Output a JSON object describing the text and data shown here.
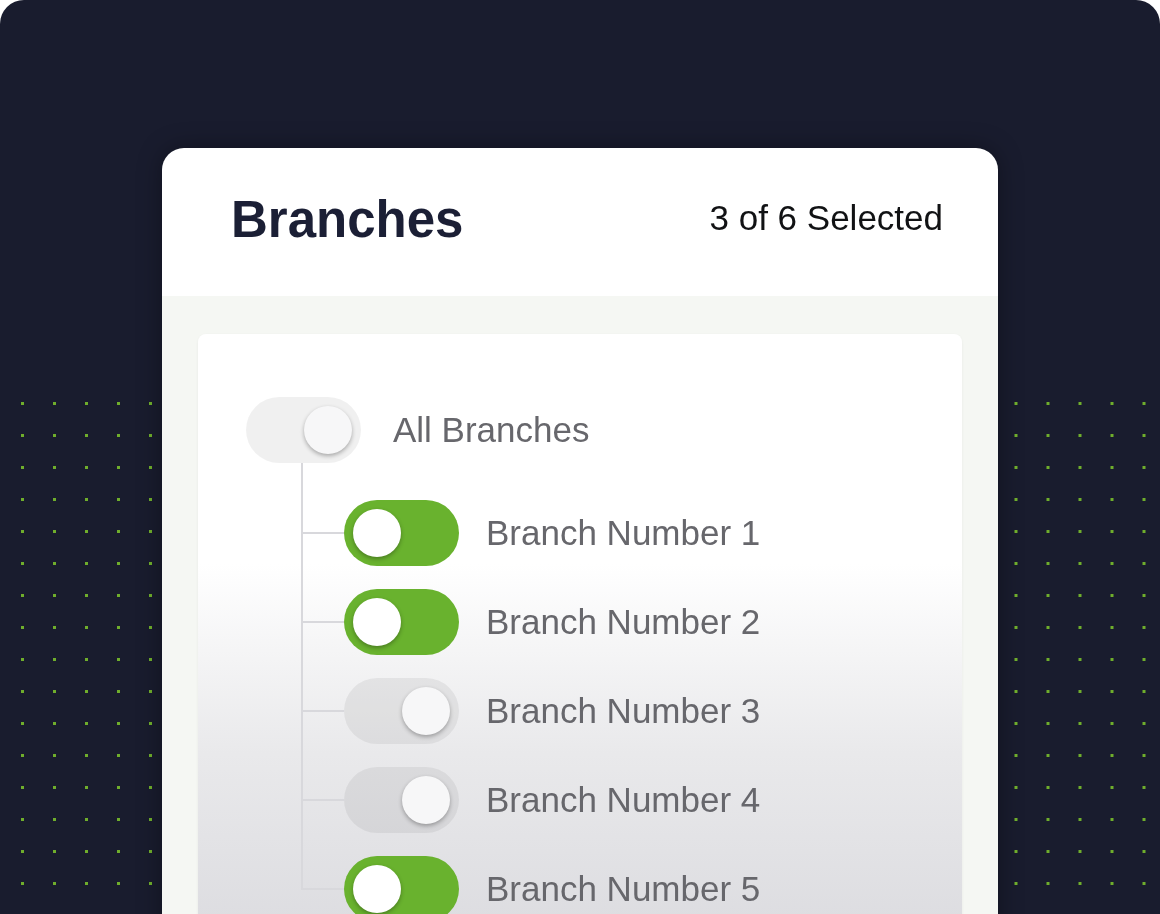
{
  "header": {
    "title": "Branches",
    "selection_count": "3 of 6 Selected"
  },
  "tree": {
    "label": "All Branches",
    "on": false,
    "children": [
      {
        "label": "Branch Number 1",
        "on": true
      },
      {
        "label": "Branch Number 2",
        "on": true
      },
      {
        "label": "Branch Number 3",
        "on": false
      },
      {
        "label": "Branch Number 4",
        "on": false
      },
      {
        "label": "Branch Number 5",
        "on": true
      }
    ]
  }
}
